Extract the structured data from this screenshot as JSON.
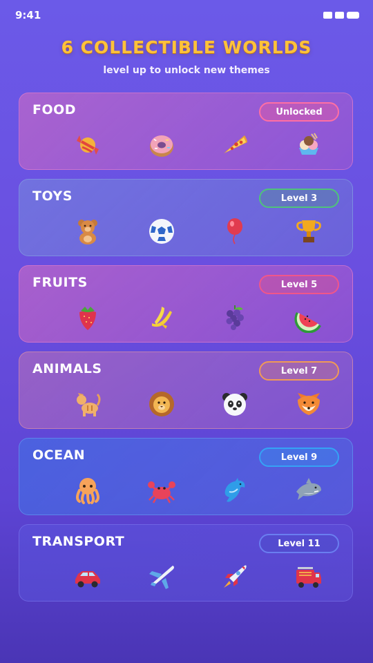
{
  "status": {
    "time": "9:41"
  },
  "header": {
    "title": "6 COLLECTIBLE WORLDS",
    "subtitle": "level up to unlock new themes"
  },
  "worlds": [
    {
      "name": "FOOD",
      "badge": "Unlocked",
      "accent": "#ff6fa3",
      "icons": [
        "candy-icon",
        "donut-icon",
        "pizza-slice-icon",
        "ice-cream-icon"
      ]
    },
    {
      "name": "TOYS",
      "badge": "Level 3",
      "accent": "#4fc37a",
      "icons": [
        "teddy-bear-icon",
        "soccer-ball-icon",
        "balloon-icon",
        "trophy-icon"
      ]
    },
    {
      "name": "FRUITS",
      "badge": "Level 5",
      "accent": "#f0568a",
      "icons": [
        "strawberry-icon",
        "banana-icon",
        "grapes-icon",
        "watermelon-icon"
      ]
    },
    {
      "name": "ANIMALS",
      "badge": "Level 7",
      "accent": "#f19a55",
      "icons": [
        "cat-icon",
        "lion-icon",
        "panda-icon",
        "fox-icon"
      ]
    },
    {
      "name": "OCEAN",
      "badge": "Level 9",
      "accent": "#35a3f5",
      "icons": [
        "octopus-icon",
        "crab-icon",
        "dolphin-icon",
        "shark-icon"
      ]
    },
    {
      "name": "TRANSPORT",
      "badge": "Level 11",
      "accent": "#6a7ef0",
      "icons": [
        "car-icon",
        "airplane-icon",
        "rocket-icon",
        "fire-truck-icon"
      ]
    }
  ]
}
